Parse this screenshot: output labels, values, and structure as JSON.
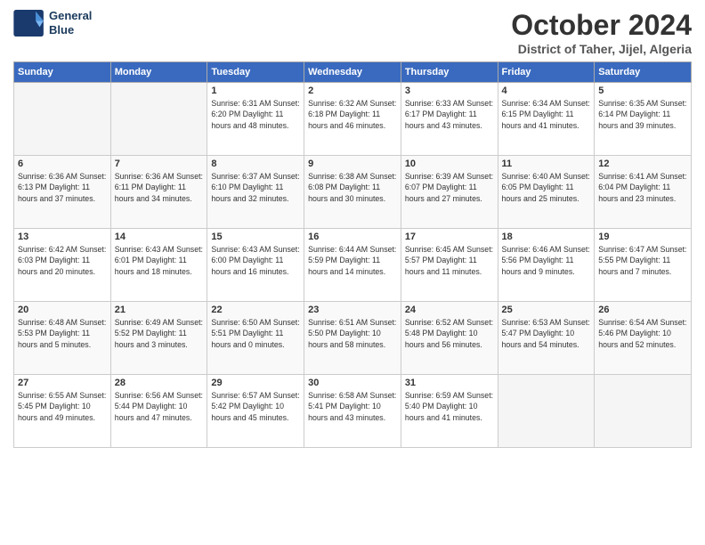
{
  "logo": {
    "line1": "General",
    "line2": "Blue"
  },
  "title": "October 2024",
  "subtitle": "District of Taher, Jijel, Algeria",
  "days_of_week": [
    "Sunday",
    "Monday",
    "Tuesday",
    "Wednesday",
    "Thursday",
    "Friday",
    "Saturday"
  ],
  "weeks": [
    [
      {
        "day": "",
        "info": ""
      },
      {
        "day": "",
        "info": ""
      },
      {
        "day": "1",
        "info": "Sunrise: 6:31 AM\nSunset: 6:20 PM\nDaylight: 11 hours and 48 minutes."
      },
      {
        "day": "2",
        "info": "Sunrise: 6:32 AM\nSunset: 6:18 PM\nDaylight: 11 hours and 46 minutes."
      },
      {
        "day": "3",
        "info": "Sunrise: 6:33 AM\nSunset: 6:17 PM\nDaylight: 11 hours and 43 minutes."
      },
      {
        "day": "4",
        "info": "Sunrise: 6:34 AM\nSunset: 6:15 PM\nDaylight: 11 hours and 41 minutes."
      },
      {
        "day": "5",
        "info": "Sunrise: 6:35 AM\nSunset: 6:14 PM\nDaylight: 11 hours and 39 minutes."
      }
    ],
    [
      {
        "day": "6",
        "info": "Sunrise: 6:36 AM\nSunset: 6:13 PM\nDaylight: 11 hours and 37 minutes."
      },
      {
        "day": "7",
        "info": "Sunrise: 6:36 AM\nSunset: 6:11 PM\nDaylight: 11 hours and 34 minutes."
      },
      {
        "day": "8",
        "info": "Sunrise: 6:37 AM\nSunset: 6:10 PM\nDaylight: 11 hours and 32 minutes."
      },
      {
        "day": "9",
        "info": "Sunrise: 6:38 AM\nSunset: 6:08 PM\nDaylight: 11 hours and 30 minutes."
      },
      {
        "day": "10",
        "info": "Sunrise: 6:39 AM\nSunset: 6:07 PM\nDaylight: 11 hours and 27 minutes."
      },
      {
        "day": "11",
        "info": "Sunrise: 6:40 AM\nSunset: 6:05 PM\nDaylight: 11 hours and 25 minutes."
      },
      {
        "day": "12",
        "info": "Sunrise: 6:41 AM\nSunset: 6:04 PM\nDaylight: 11 hours and 23 minutes."
      }
    ],
    [
      {
        "day": "13",
        "info": "Sunrise: 6:42 AM\nSunset: 6:03 PM\nDaylight: 11 hours and 20 minutes."
      },
      {
        "day": "14",
        "info": "Sunrise: 6:43 AM\nSunset: 6:01 PM\nDaylight: 11 hours and 18 minutes."
      },
      {
        "day": "15",
        "info": "Sunrise: 6:43 AM\nSunset: 6:00 PM\nDaylight: 11 hours and 16 minutes."
      },
      {
        "day": "16",
        "info": "Sunrise: 6:44 AM\nSunset: 5:59 PM\nDaylight: 11 hours and 14 minutes."
      },
      {
        "day": "17",
        "info": "Sunrise: 6:45 AM\nSunset: 5:57 PM\nDaylight: 11 hours and 11 minutes."
      },
      {
        "day": "18",
        "info": "Sunrise: 6:46 AM\nSunset: 5:56 PM\nDaylight: 11 hours and 9 minutes."
      },
      {
        "day": "19",
        "info": "Sunrise: 6:47 AM\nSunset: 5:55 PM\nDaylight: 11 hours and 7 minutes."
      }
    ],
    [
      {
        "day": "20",
        "info": "Sunrise: 6:48 AM\nSunset: 5:53 PM\nDaylight: 11 hours and 5 minutes."
      },
      {
        "day": "21",
        "info": "Sunrise: 6:49 AM\nSunset: 5:52 PM\nDaylight: 11 hours and 3 minutes."
      },
      {
        "day": "22",
        "info": "Sunrise: 6:50 AM\nSunset: 5:51 PM\nDaylight: 11 hours and 0 minutes."
      },
      {
        "day": "23",
        "info": "Sunrise: 6:51 AM\nSunset: 5:50 PM\nDaylight: 10 hours and 58 minutes."
      },
      {
        "day": "24",
        "info": "Sunrise: 6:52 AM\nSunset: 5:48 PM\nDaylight: 10 hours and 56 minutes."
      },
      {
        "day": "25",
        "info": "Sunrise: 6:53 AM\nSunset: 5:47 PM\nDaylight: 10 hours and 54 minutes."
      },
      {
        "day": "26",
        "info": "Sunrise: 6:54 AM\nSunset: 5:46 PM\nDaylight: 10 hours and 52 minutes."
      }
    ],
    [
      {
        "day": "27",
        "info": "Sunrise: 6:55 AM\nSunset: 5:45 PM\nDaylight: 10 hours and 49 minutes."
      },
      {
        "day": "28",
        "info": "Sunrise: 6:56 AM\nSunset: 5:44 PM\nDaylight: 10 hours and 47 minutes."
      },
      {
        "day": "29",
        "info": "Sunrise: 6:57 AM\nSunset: 5:42 PM\nDaylight: 10 hours and 45 minutes."
      },
      {
        "day": "30",
        "info": "Sunrise: 6:58 AM\nSunset: 5:41 PM\nDaylight: 10 hours and 43 minutes."
      },
      {
        "day": "31",
        "info": "Sunrise: 6:59 AM\nSunset: 5:40 PM\nDaylight: 10 hours and 41 minutes."
      },
      {
        "day": "",
        "info": ""
      },
      {
        "day": "",
        "info": ""
      }
    ]
  ]
}
